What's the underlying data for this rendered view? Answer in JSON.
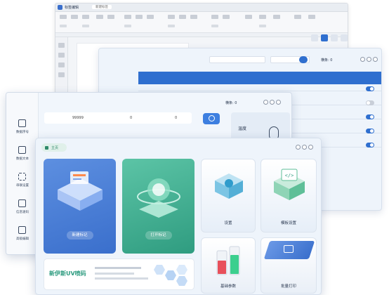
{
  "editor": {
    "title": "标签编辑",
    "tab": "新建标签"
  },
  "table_window": {
    "print_range_label": "",
    "print_range_a": "",
    "print_range_b": "",
    "row_label": "横条: 0",
    "columns": [
      "",
      "",
      "",
      "",
      "",
      "",
      "",
      "",
      "",
      "",
      ""
    ],
    "toggles": [
      true,
      false,
      true,
      true,
      true
    ]
  },
  "main_window": {
    "sidebar": [
      {
        "label": "数据序号",
        "icon": "list-icon"
      },
      {
        "label": "数据文本",
        "icon": "document-icon"
      },
      {
        "label": "串联设置",
        "icon": "grid-icon"
      },
      {
        "label": "信息速码",
        "icon": "calendar-icon"
      },
      {
        "label": "高级编辑",
        "icon": "edit-icon"
      }
    ],
    "stats": {
      "value1": "99999",
      "value2": "0",
      "value3": "0"
    },
    "row_label": "横条: 0",
    "right_card_text": "温度"
  },
  "home": {
    "tab_label": "主页",
    "tiles": {
      "new_label": "新建标记",
      "open_label": "打开标记",
      "settings_label": "设置",
      "template_label": "模板设置",
      "basic_label": "基础参数",
      "batch_label": "批量打印"
    },
    "brand": "新伊斯UV喷码",
    "brand_lines": [
      "",
      ""
    ],
    "colors": {
      "blue": "#3a6fcc",
      "green": "#2f9c80",
      "accent": "#2f6fcf"
    }
  }
}
